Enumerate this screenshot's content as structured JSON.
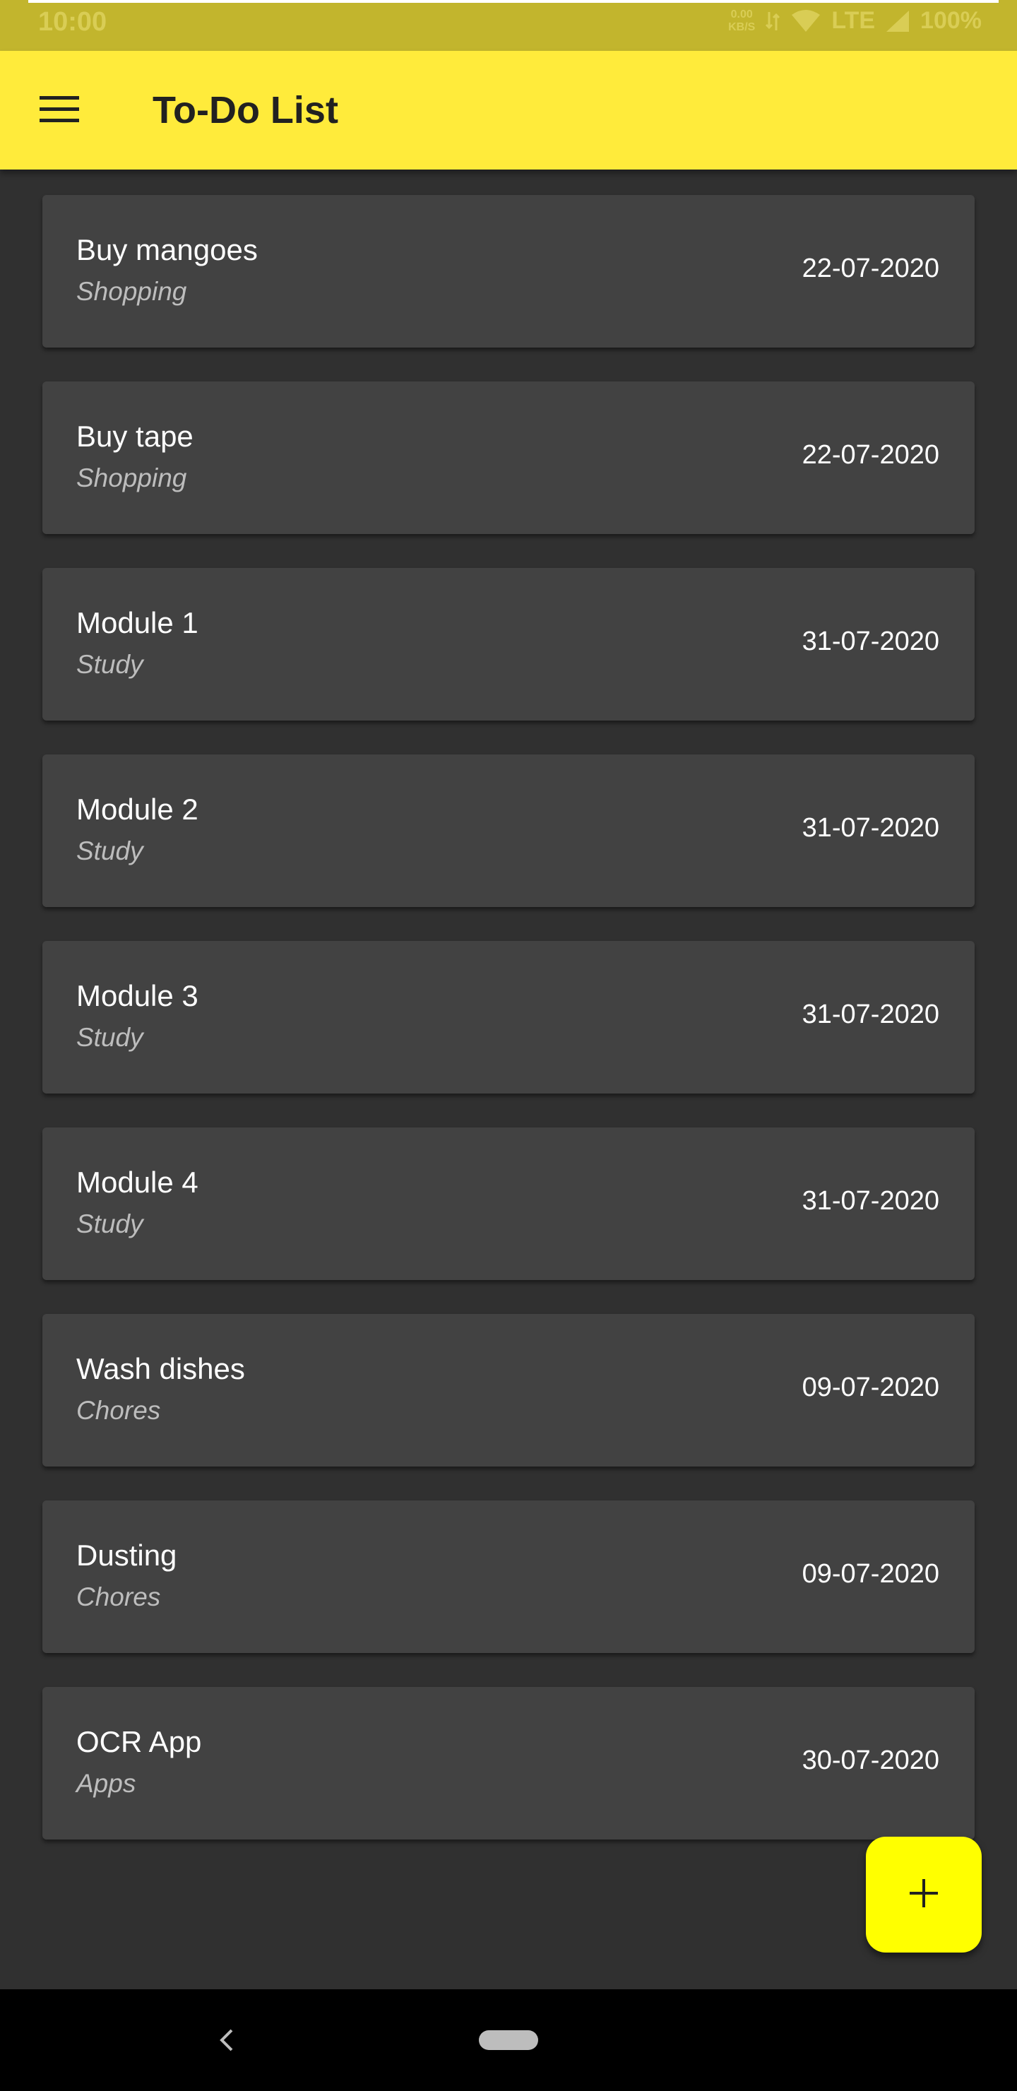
{
  "status_bar": {
    "time": "10:00",
    "network_speed_top": "0.00",
    "network_speed_bottom": "KB/S",
    "network_type": "LTE",
    "battery": "100%"
  },
  "app_bar": {
    "title": "To-Do List",
    "menu_icon": "hamburger-menu-icon",
    "background_color": "#ffeb3b"
  },
  "tasks": [
    {
      "title": "Buy mangoes",
      "category": "Shopping",
      "date": "22-07-2020"
    },
    {
      "title": "Buy tape",
      "category": "Shopping",
      "date": "22-07-2020"
    },
    {
      "title": "Module 1",
      "category": "Study",
      "date": "31-07-2020"
    },
    {
      "title": "Module 2",
      "category": "Study",
      "date": "31-07-2020"
    },
    {
      "title": "Module 3",
      "category": "Study",
      "date": "31-07-2020"
    },
    {
      "title": "Module 4",
      "category": "Study",
      "date": "31-07-2020"
    },
    {
      "title": "Wash dishes",
      "category": "Chores",
      "date": "09-07-2020"
    },
    {
      "title": "Dusting",
      "category": "Chores",
      "date": "09-07-2020"
    },
    {
      "title": "OCR App",
      "category": "Apps",
      "date": "30-07-2020"
    }
  ],
  "fab": {
    "icon": "plus-icon",
    "color": "#ffff00"
  },
  "nav_bar": {
    "back_icon": "chevron-left-icon",
    "home_icon": "home-pill-icon"
  },
  "theme": {
    "background": "#303030",
    "card": "#424242"
  }
}
